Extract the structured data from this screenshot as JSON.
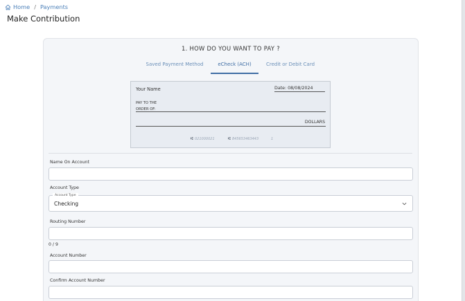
{
  "breadcrumb": {
    "home": "Home",
    "separator": "/",
    "current": "Payments",
    "home_icon": "home-icon"
  },
  "page": {
    "title": "Make Contribution"
  },
  "payment": {
    "step_title": "1. HOW DO YOU WANT TO PAY ?",
    "tabs": [
      {
        "label": "Saved Payment Method",
        "active": false
      },
      {
        "label": "eCheck (ACH)",
        "active": true
      },
      {
        "label": "Credit or Debit Card",
        "active": false
      }
    ]
  },
  "cheque": {
    "your_name": "Your Name",
    "date": "Date: 08/08/2024",
    "pay_to_line1": "PAY TO THE",
    "pay_to_line2": "ORDER OF:",
    "dollars": "DOLLARS",
    "micr_routing_glyph": "⑆",
    "micr_routing": "021000021",
    "micr_account_glyph": "⑆",
    "micr_account": "845653463443",
    "micr_check": "1"
  },
  "form": {
    "name_on_account": {
      "label": "Name On Account",
      "value": ""
    },
    "account_type": {
      "label": "Account Type",
      "legend": "Account Type",
      "value": "Checking"
    },
    "routing_number": {
      "label": "Routing Number",
      "value": "",
      "counter": "0 / 9"
    },
    "account_number": {
      "label": "Account Number",
      "value": ""
    },
    "confirm_account_number": {
      "label": "Confirm Account Number",
      "value": ""
    }
  },
  "colors": {
    "accent": "#3e6da4",
    "link": "#4a7fb8",
    "card_bg": "#f4f6f9",
    "cheque_bg": "#e8ecf2"
  }
}
